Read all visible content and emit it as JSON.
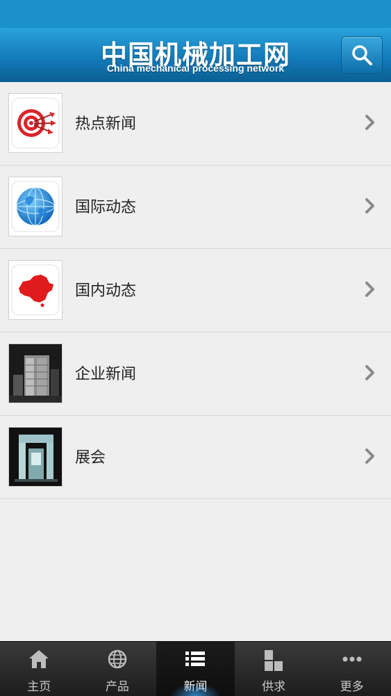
{
  "header": {
    "title": "中国机械加工网",
    "subtitle": "China mechanical processing network",
    "search_icon": "search-icon"
  },
  "list": {
    "items": [
      {
        "label": "热点新闻",
        "icon": "target-icon"
      },
      {
        "label": "国际动态",
        "icon": "globe-icon"
      },
      {
        "label": "国内动态",
        "icon": "china-map-icon"
      },
      {
        "label": "企业新闻",
        "icon": "building-photo"
      },
      {
        "label": "展会",
        "icon": "exhibition-booth-photo"
      }
    ]
  },
  "tabbar": {
    "active_tab": "新闻",
    "tabs": [
      {
        "label": "主页",
        "icon": "home-icon"
      },
      {
        "label": "产品",
        "icon": "globe-icon"
      },
      {
        "label": "新闻",
        "icon": "list-icon"
      },
      {
        "label": "供求",
        "icon": "blocks-icon"
      },
      {
        "label": "更多",
        "icon": "more-icon"
      }
    ]
  },
  "colors": {
    "header": "#137cbb",
    "background": "#efefef",
    "tabbar": "#1d1d1d"
  }
}
